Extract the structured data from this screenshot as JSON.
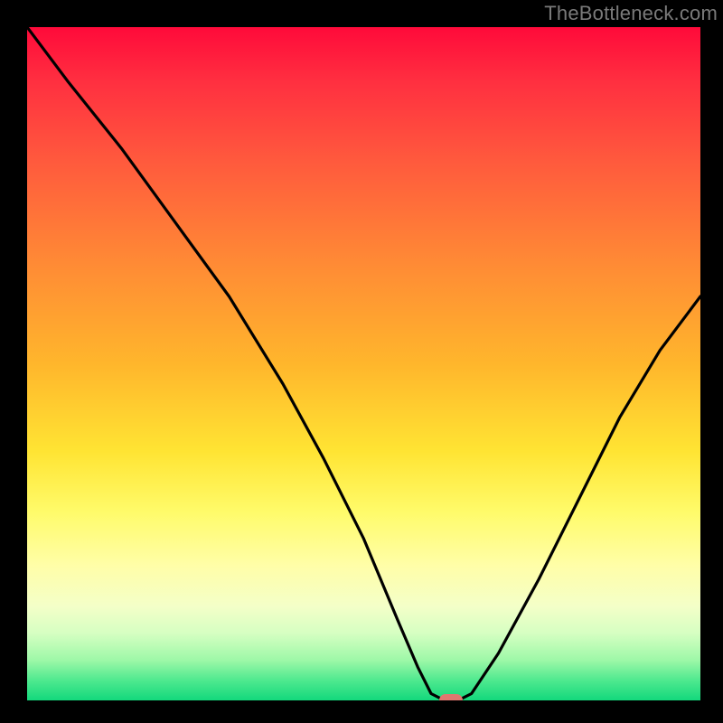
{
  "watermark": "TheBottleneck.com",
  "chart_data": {
    "type": "line",
    "title": "",
    "xlabel": "",
    "ylabel": "",
    "xlim": [
      0,
      100
    ],
    "ylim": [
      0,
      100
    ],
    "x": [
      0,
      6,
      14,
      22,
      30,
      38,
      44,
      50,
      55,
      58,
      60,
      62,
      64,
      66,
      70,
      76,
      82,
      88,
      94,
      100
    ],
    "y": [
      100,
      92,
      82,
      71,
      60,
      47,
      36,
      24,
      12,
      5,
      1,
      0,
      0,
      1,
      7,
      18,
      30,
      42,
      52,
      60
    ],
    "series": [
      {
        "name": "bottleneck-curve",
        "values": [
          100,
          92,
          82,
          71,
          60,
          47,
          36,
          24,
          12,
          5,
          1,
          0,
          0,
          1,
          7,
          18,
          30,
          42,
          52,
          60
        ]
      }
    ],
    "marker": {
      "x": 63,
      "y": 0
    },
    "background_gradient": {
      "stops": [
        {
          "pos": 0,
          "color": "#ff0a3a"
        },
        {
          "pos": 50,
          "color": "#ffb62c"
        },
        {
          "pos": 75,
          "color": "#fffb6a"
        },
        {
          "pos": 100,
          "color": "#13d87c"
        }
      ]
    }
  }
}
